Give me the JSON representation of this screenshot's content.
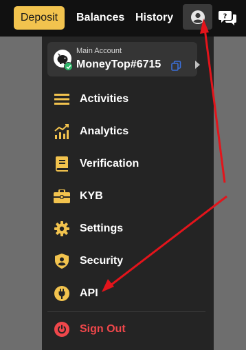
{
  "header": {
    "deposit_label": "Deposit",
    "nav": [
      {
        "label": "Balances"
      },
      {
        "label": "History"
      }
    ]
  },
  "account": {
    "label": "Main Account",
    "name": "MoneyTop#6715"
  },
  "menu": [
    {
      "label": "Activities",
      "icon": "list-icon"
    },
    {
      "label": "Analytics",
      "icon": "chart-icon"
    },
    {
      "label": "Verification",
      "icon": "book-icon"
    },
    {
      "label": "KYB",
      "icon": "briefcase-icon"
    },
    {
      "label": "Settings",
      "icon": "gear-icon"
    },
    {
      "label": "Security",
      "icon": "shield-user-icon"
    },
    {
      "label": "API",
      "icon": "plug-icon"
    }
  ],
  "signout": {
    "label": "Sign Out",
    "icon": "power-icon"
  },
  "colors": {
    "accent": "#f2c34e",
    "danger": "#f0474b",
    "annotation": "#e3141b",
    "verified": "#2eb86a",
    "copy": "#3b6fd9"
  }
}
